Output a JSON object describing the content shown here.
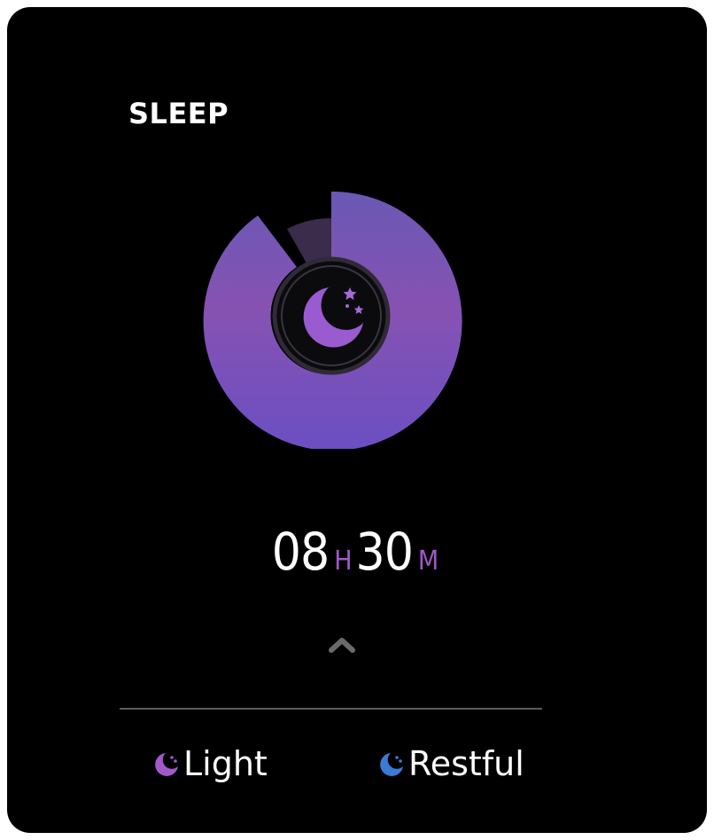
{
  "header": {
    "title": "SLEEP"
  },
  "sleep_ring": {
    "icon": "moon-stars-icon",
    "colors": {
      "ring_top": "#6d56b2",
      "ring_bottom": "#6d4ec0",
      "ring_mid": "#8453b4",
      "track": "#3a2c4a",
      "center_fill": "#0b0b0d",
      "moon": "#9a5ad0"
    }
  },
  "duration": {
    "hours": "08",
    "hours_unit": "H",
    "minutes": "30",
    "minutes_unit": "M"
  },
  "expand": {
    "icon": "chevron-up-icon"
  },
  "legend": {
    "items": [
      {
        "label": "Light",
        "icon": "moon-icon",
        "color": "#a158c8"
      },
      {
        "label": "Restful",
        "icon": "moon-icon",
        "color": "#3a7bd5"
      }
    ]
  }
}
